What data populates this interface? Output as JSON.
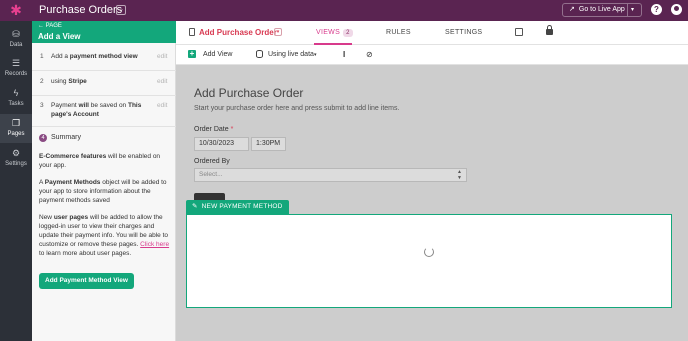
{
  "app": {
    "title": "Purchase Orders",
    "go_live_label": "Go to Live App"
  },
  "rail": {
    "items": [
      {
        "label": "Data",
        "icon": "data-icon"
      },
      {
        "label": "Records",
        "icon": "database-icon"
      },
      {
        "label": "Tasks",
        "icon": "bolt-icon"
      },
      {
        "label": "Pages",
        "icon": "pages-icon"
      },
      {
        "label": "Settings",
        "icon": "gear-icon"
      }
    ],
    "active": "Pages"
  },
  "panel": {
    "back_label": "PAGE",
    "title": "Add a View",
    "steps": [
      {
        "num": "1",
        "pre": "Add a ",
        "bold": "payment method view",
        "post": "",
        "edit": "edit"
      },
      {
        "num": "2",
        "pre": "using ",
        "bold": "Stripe",
        "post": "",
        "edit": "edit"
      },
      {
        "num": "3",
        "pre": "Payment ",
        "bold": "will",
        "post": " be saved on ",
        "bold2": "This page's Account",
        "edit": "edit"
      }
    ],
    "summary": {
      "num": "4",
      "label": "Summary",
      "p1_bold": "E-Commerce features",
      "p1_rest": " will be enabled on your app.",
      "p2_pre": "A ",
      "p2_bold": "Payment Methods",
      "p2_rest": " object will be added to your app to store information about the payment methods saved",
      "p3_pre": "New ",
      "p3_bold": "user pages",
      "p3_rest": " will be added to allow the logged-in user to view their charges and update their payment info. You will be able to customize or remove these pages. ",
      "p3_link": "Click here",
      "p3_end": " to learn more about user pages."
    },
    "button_label": "Add Payment Method View"
  },
  "tabs": {
    "page_name": "Add Purchase Order",
    "views_label": "VIEWS",
    "views_count": "2",
    "rules_label": "RULES",
    "settings_label": "SETTINGS"
  },
  "toolbar": {
    "add_view_label": "Add View",
    "data_mode_label": "Using live data"
  },
  "form": {
    "title": "Add Purchase Order",
    "description": "Start your purchase order here and press submit to add line items.",
    "order_date_label": "Order Date",
    "required_mark": "*",
    "date_value": "10/30/2023",
    "time_value": "1:30PM",
    "ordered_by_label": "Ordered By",
    "select_placeholder": "Select...",
    "new_view_tag": "NEW PAYMENT METHOD"
  },
  "colors": {
    "topbar": "#5a2451",
    "accent_green": "#13a77b",
    "accent_pink": "#d83a8c",
    "rail": "#2c3038"
  }
}
